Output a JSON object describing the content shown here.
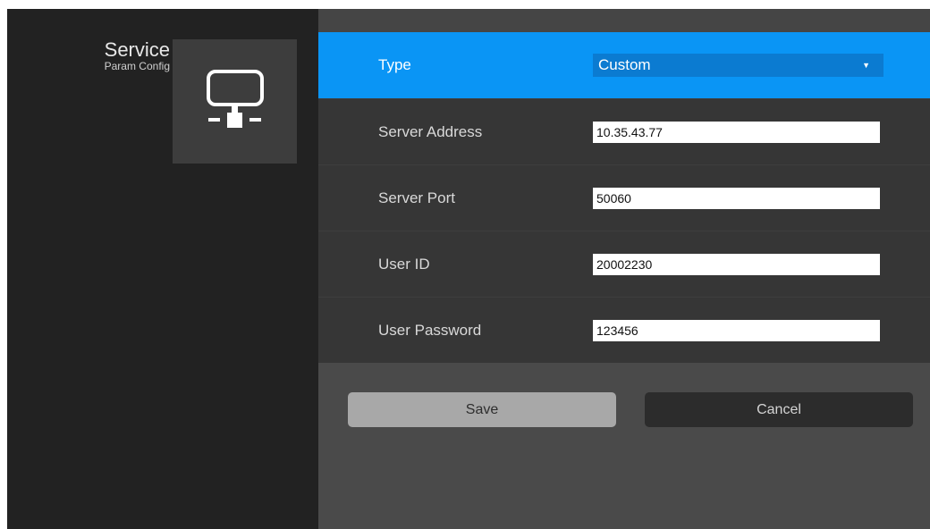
{
  "sidebar": {
    "title": "Service",
    "subtitle": "Param Config",
    "tile_icon": "network-monitor-icon"
  },
  "form": {
    "rows": [
      {
        "label": "Type",
        "value": "Custom",
        "control": "select",
        "arrow": "▼"
      },
      {
        "label": "Server Address",
        "value": "10.35.43.77",
        "control": "text"
      },
      {
        "label": "Server Port",
        "value": "50060",
        "control": "text"
      },
      {
        "label": "User ID",
        "value": "20002230",
        "control": "text"
      },
      {
        "label": "User Password",
        "value": "123456",
        "control": "text"
      }
    ]
  },
  "actions": {
    "save_label": "Save",
    "cancel_label": "Cancel"
  },
  "colors": {
    "accent": "#0a95f5",
    "select_fill": "#0b7bd1",
    "sidebar_bg": "#222222",
    "panel_bg": "#4a4a4a",
    "row_bg": "#363636"
  }
}
